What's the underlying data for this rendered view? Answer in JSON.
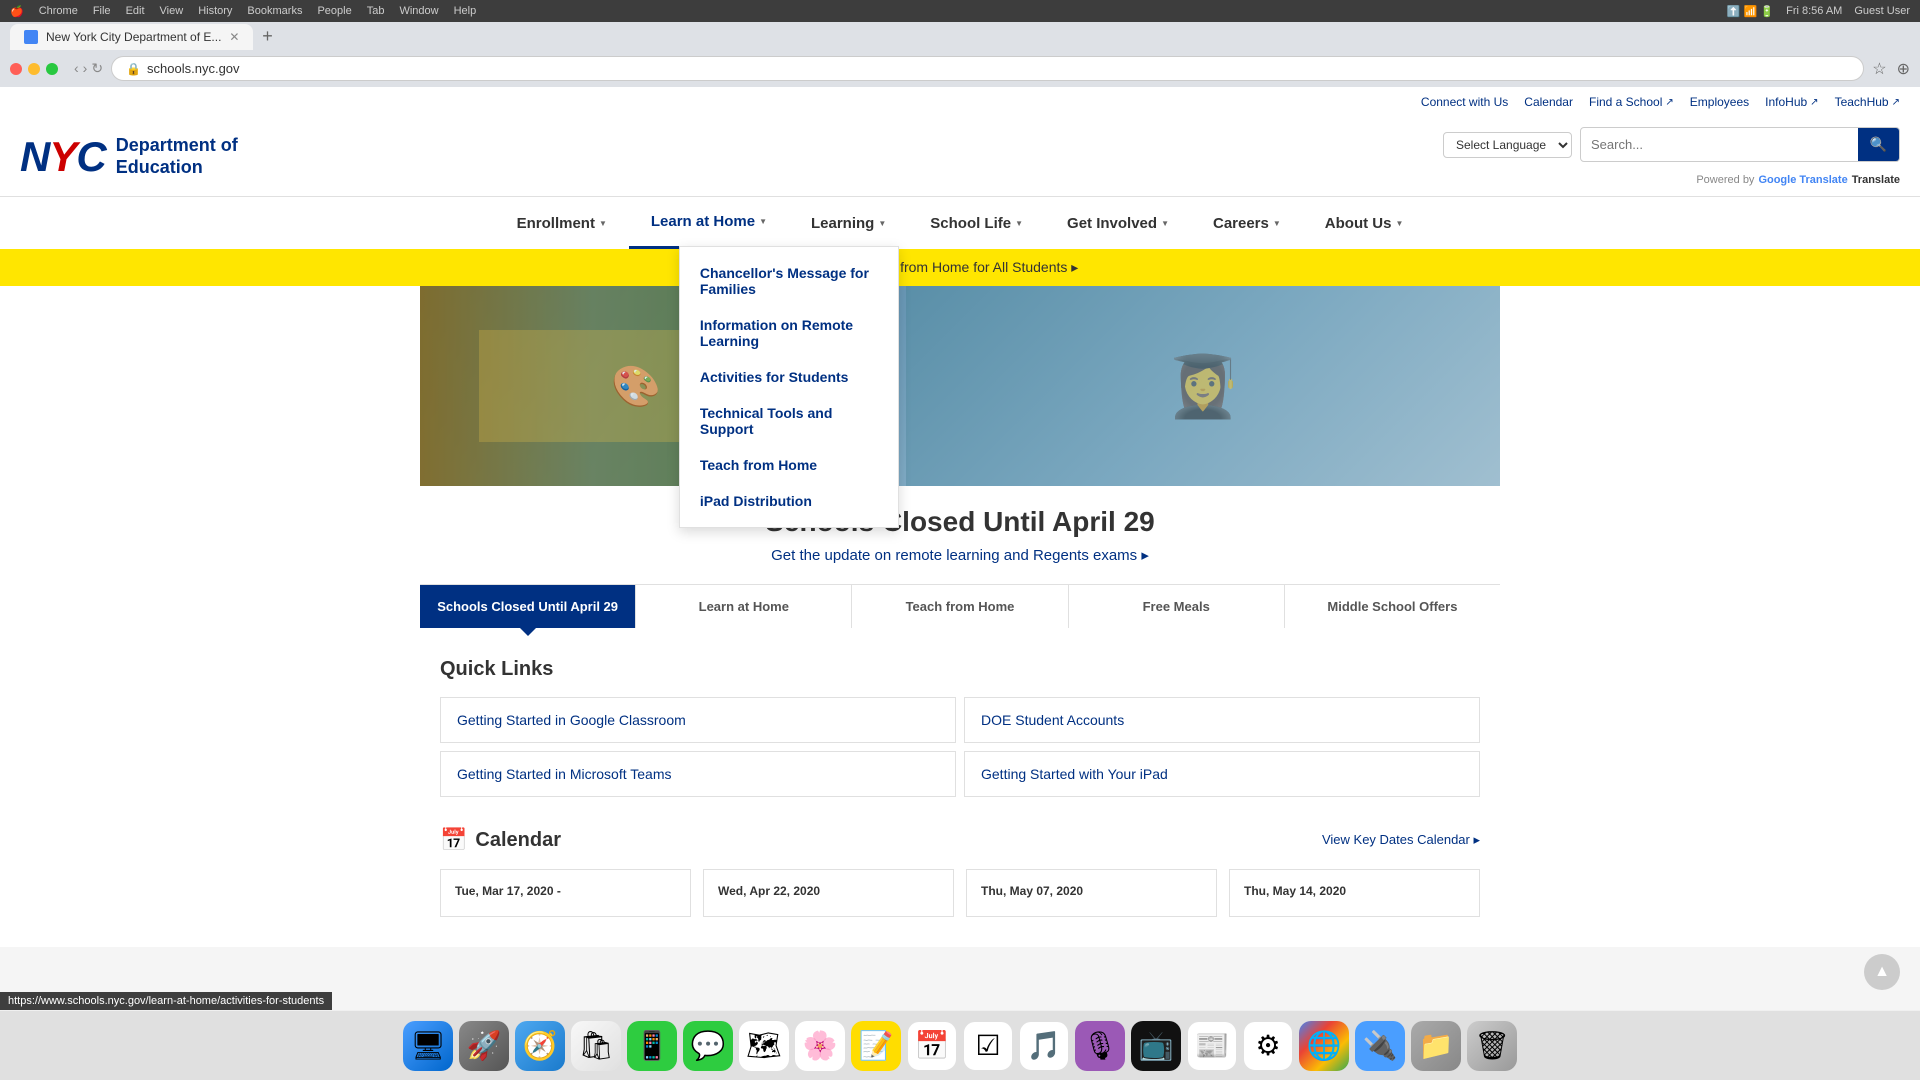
{
  "browser": {
    "menu_items": [
      "Chrome",
      "File",
      "Edit",
      "View",
      "History",
      "Bookmarks",
      "People",
      "Tab",
      "Window",
      "Help"
    ],
    "time": "Fri 8:56 AM",
    "user": "Guest User",
    "tab_title": "New York City Department of E...",
    "address": "schools.nyc.gov"
  },
  "utility_nav": {
    "links": [
      {
        "label": "Connect with Us",
        "external": false
      },
      {
        "label": "Calendar",
        "external": false
      },
      {
        "label": "Find a School",
        "external": true
      },
      {
        "label": "Employees",
        "external": false
      },
      {
        "label": "InfoHub",
        "external": true
      },
      {
        "label": "TeachHub",
        "external": true
      }
    ]
  },
  "header": {
    "logo_nyc": "NYC",
    "logo_dept": "Department of\nEducation",
    "search_placeholder": "Search...",
    "search_button": "🔍",
    "language_select": "Select Language",
    "powered_by": "Powered by",
    "google_translate": "Google Translate"
  },
  "main_nav": {
    "items": [
      {
        "label": "Enrollment",
        "active": false
      },
      {
        "label": "Learn at Home",
        "active": true
      },
      {
        "label": "Learning",
        "active": false
      },
      {
        "label": "School Life",
        "active": false
      },
      {
        "label": "Get Involved",
        "active": false
      },
      {
        "label": "Careers",
        "active": false
      },
      {
        "label": "About Us",
        "active": false
      }
    ]
  },
  "dropdown": {
    "items": [
      {
        "label": "Chancellor's Message for Families"
      },
      {
        "label": "Information on Remote Learning"
      },
      {
        "label": "Activities for Students"
      },
      {
        "label": "Technical Tools and Support"
      },
      {
        "label": "Teach from Home"
      },
      {
        "label": "iPad Distribution"
      }
    ]
  },
  "yellow_banner": {
    "text": "Learning from Home for All Students ▸"
  },
  "hero": {
    "title": "Schools Closed Until April 29",
    "subtitle": "Get the update on remote learning and Regents exams ▸"
  },
  "content_tabs": [
    {
      "label": "Schools Closed Until April 29",
      "active": true
    },
    {
      "label": "Learn at Home",
      "active": false
    },
    {
      "label": "Teach from Home",
      "active": false
    },
    {
      "label": "Free Meals",
      "active": false
    },
    {
      "label": "Middle School Offers",
      "active": false
    }
  ],
  "quick_links": {
    "title": "Quick Links",
    "items": [
      {
        "label": "Getting Started in Google Classroom"
      },
      {
        "label": "DOE Student Accounts"
      },
      {
        "label": "Getting Started in Microsoft Teams"
      },
      {
        "label": "Getting Started with Your iPad"
      }
    ]
  },
  "calendar": {
    "title": "Calendar",
    "view_all": "View Key Dates Calendar ▸",
    "cards": [
      {
        "date": "Tue, Mar 17, 2020 -"
      },
      {
        "date": "Wed, Apr 22, 2020"
      },
      {
        "date": "Thu, May 07, 2020"
      },
      {
        "date": "Thu, May 14, 2020"
      }
    ]
  },
  "status_bar": {
    "url": "https://www.schools.nyc.gov/learn-at-home/activities-for-students"
  },
  "dock": {
    "icons": [
      "🖥",
      "🚀",
      "🧭",
      "🛍",
      "📱",
      "💬",
      "🗺",
      "🌸",
      "📝",
      "📅",
      "☑",
      "🎵",
      "🎙",
      "📺",
      "📰",
      "⚙",
      "🌐",
      "🔌",
      "📁",
      "🗑"
    ]
  }
}
